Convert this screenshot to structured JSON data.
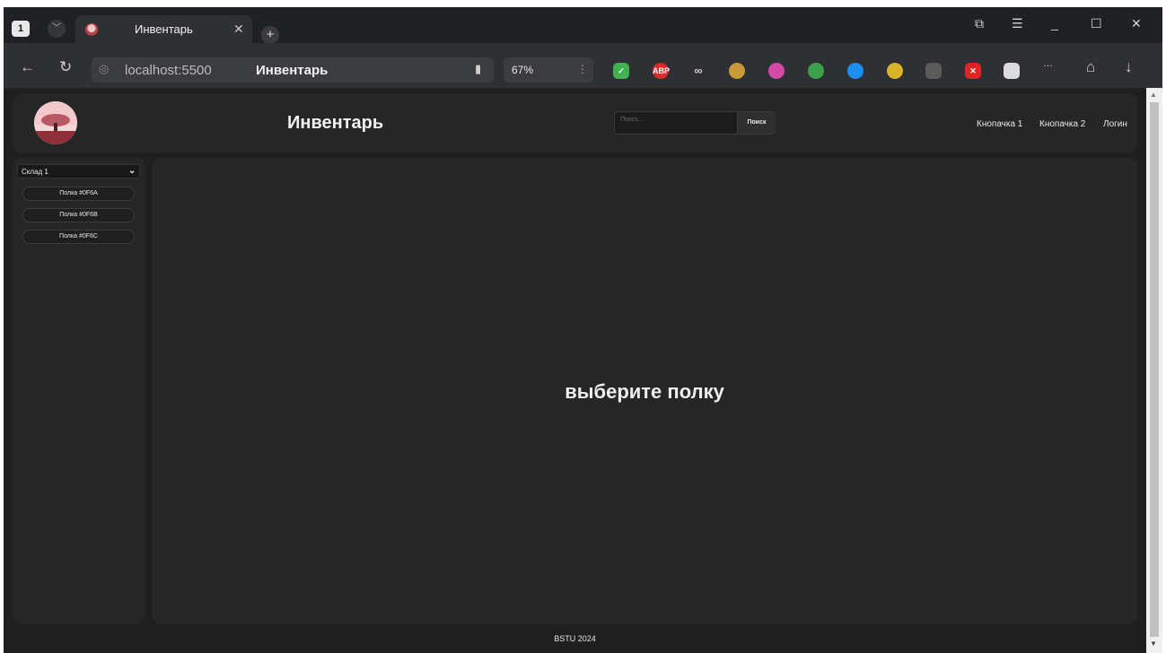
{
  "browser": {
    "tab_count": "1",
    "tab_title": "Инвентарь",
    "url": "localhost:5500",
    "page_title": "Инвентарь",
    "zoom": "67%",
    "extensions": [
      "shield-check-icon",
      "abp-icon",
      "glasses-icon",
      "puzzle-icon",
      "screenshot-icon",
      "chat-icon",
      "shazam-icon",
      "coin-icon",
      "camera-icon",
      "red-x-icon",
      "qr-icon"
    ],
    "extension_labels": {
      "abp": "ABP"
    }
  },
  "header": {
    "title": "Инвентарь",
    "search_placeholder": "Поиск...",
    "search_button": "Поиск",
    "nav": [
      "Кнопачка 1",
      "Кнопачка 2",
      "Логин"
    ]
  },
  "sidebar": {
    "warehouse": "Склад 1",
    "shelves": [
      "Полка #0F6A",
      "Полка #0F6B",
      "Полка #0F6C"
    ]
  },
  "main": {
    "empty_text": "выберите полку"
  },
  "footer": {
    "text": "BSTU 2024"
  },
  "colors": {
    "page_bg": "#1f1f1f",
    "panel_bg": "#262626",
    "text": "#eeeeee"
  }
}
